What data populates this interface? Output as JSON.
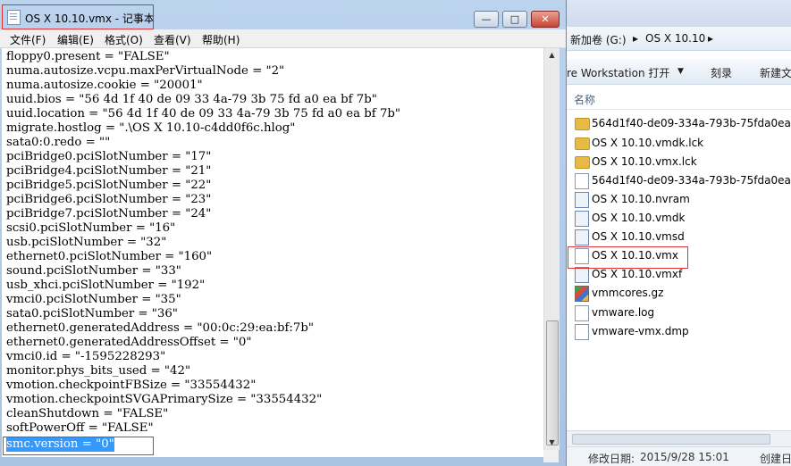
{
  "notepad": {
    "title": "OS X 10.10.vmx - 记事本",
    "window_buttons": {
      "minimize": "—",
      "maximize": "□",
      "close": "✕"
    },
    "menus": [
      "文件(F)",
      "编辑(E)",
      "格式(O)",
      "查看(V)",
      "帮助(H)"
    ],
    "lines": [
      "floppy0.present = \"FALSE\"",
      "numa.autosize.vcpu.maxPerVirtualNode = \"2\"",
      "numa.autosize.cookie = \"20001\"",
      "uuid.bios = \"56 4d 1f 40 de 09 33 4a-79 3b 75 fd a0 ea bf 7b\"",
      "uuid.location = \"56 4d 1f 40 de 09 33 4a-79 3b 75 fd a0 ea bf 7b\"",
      "migrate.hostlog = \".\\OS X 10.10-c4dd0f6c.hlog\"",
      "sata0:0.redo = \"\"",
      "pciBridge0.pciSlotNumber = \"17\"",
      "pciBridge4.pciSlotNumber = \"21\"",
      "pciBridge5.pciSlotNumber = \"22\"",
      "pciBridge6.pciSlotNumber = \"23\"",
      "pciBridge7.pciSlotNumber = \"24\"",
      "scsi0.pciSlotNumber = \"16\"",
      "usb.pciSlotNumber = \"32\"",
      "ethernet0.pciSlotNumber = \"160\"",
      "sound.pciSlotNumber = \"33\"",
      "usb_xhci.pciSlotNumber = \"192\"",
      "vmci0.pciSlotNumber = \"35\"",
      "sata0.pciSlotNumber = \"36\"",
      "ethernet0.generatedAddress = \"00:0c:29:ea:bf:7b\"",
      "ethernet0.generatedAddressOffset = \"0\"",
      "vmci0.id = \"-1595228293\"",
      "monitor.phys_bits_used = \"42\"",
      "vmotion.checkpointFBSize = \"33554432\"",
      "vmotion.checkpointSVGAPrimarySize = \"33554432\"",
      "cleanShutdown = \"FALSE\"",
      "softPowerOff = \"FALSE\"",
      "smc.version = \"0\""
    ],
    "selected_line": "smc.version = \"0\""
  },
  "explorer": {
    "address": {
      "drive": "新加卷 (G:)",
      "folder": "OS X 10.10",
      "sep": "▸"
    },
    "toolbar": {
      "open_with": "re Workstation 打开",
      "burn": "刻录",
      "new": "新建文"
    },
    "column_name": "名称",
    "files": [
      {
        "name": "564d1f40-de09-334a-793b-75fda0ea",
        "icon": "folder-icon"
      },
      {
        "name": "OS X 10.10.vmdk.lck",
        "icon": "folder-icon"
      },
      {
        "name": "OS X 10.10.vmx.lck",
        "icon": "folder-icon"
      },
      {
        "name": "564d1f40-de09-334a-793b-75fda0ea",
        "icon": "file-icon"
      },
      {
        "name": "OS X 10.10.nvram",
        "icon": "nvram-file-icon"
      },
      {
        "name": "OS X 10.10.vmdk",
        "icon": "disk-file-icon"
      },
      {
        "name": "OS X 10.10.vmsd",
        "icon": "vm-file-icon"
      },
      {
        "name": "OS X 10.10.vmx",
        "icon": "vmx-file-icon"
      },
      {
        "name": "OS X 10.10.vmxf",
        "icon": "vm-file-icon"
      },
      {
        "name": "vmmcores.gz",
        "icon": "archive-icon"
      },
      {
        "name": "vmware.log",
        "icon": "file-icon"
      },
      {
        "name": "vmware-vmx.dmp",
        "icon": "file-icon"
      }
    ],
    "status": {
      "label": "修改日期:",
      "value": "2015/9/28 15:01",
      "extra": "创建日"
    }
  }
}
